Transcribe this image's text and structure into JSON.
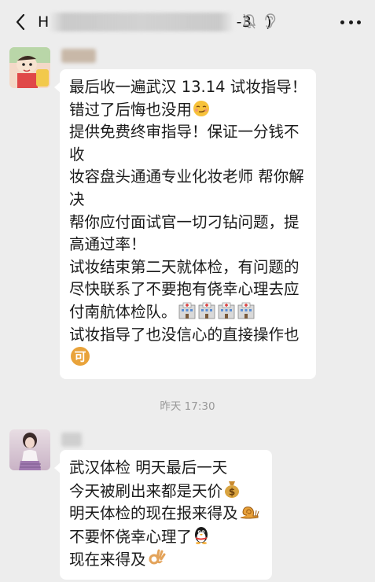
{
  "header": {
    "title_visible_start": "H",
    "title_visible_end": "-3",
    "title_suffix": ")"
  },
  "messages": [
    {
      "lines": [
        "最后收一遍武汉 13.14 试妆指导！",
        "错过了后悔也没用",
        "提供免费终审指导！保证一分钱不",
        "收",
        "妆容盘头通通专业化妆老师 帮你解",
        "决",
        "帮你应付面试官一切刁钻问题，提",
        "高通过率！",
        "试妆结束第二天就体检，有问题的",
        "尽快联系了不要抱有侥幸心理去应",
        "付南航体检队。",
        "试妆指导了也没信心的直接操作也"
      ]
    },
    {
      "lines": [
        "武汉体检 明天最后一天",
        "今天被刷出来都是天价",
        "明天体检的现在报来得及",
        "不要怀侥幸心理了",
        "现在来得及"
      ]
    }
  ],
  "timestamp": "昨天 17:30",
  "colors": {
    "background": "#ededed",
    "bubble": "#ffffff",
    "timestamp": "#9a9a9a"
  },
  "icons": [
    "back-arrow-icon",
    "mute-bell-icon",
    "ear-icon",
    "more-dots-icon",
    "smirk-emoji-icon",
    "hospital-emoji-icon",
    "ke-emoji-icon",
    "money-bag-emoji-icon",
    "snail-emoji-icon",
    "penguin-emoji-icon",
    "ok-hand-emoji-icon"
  ]
}
